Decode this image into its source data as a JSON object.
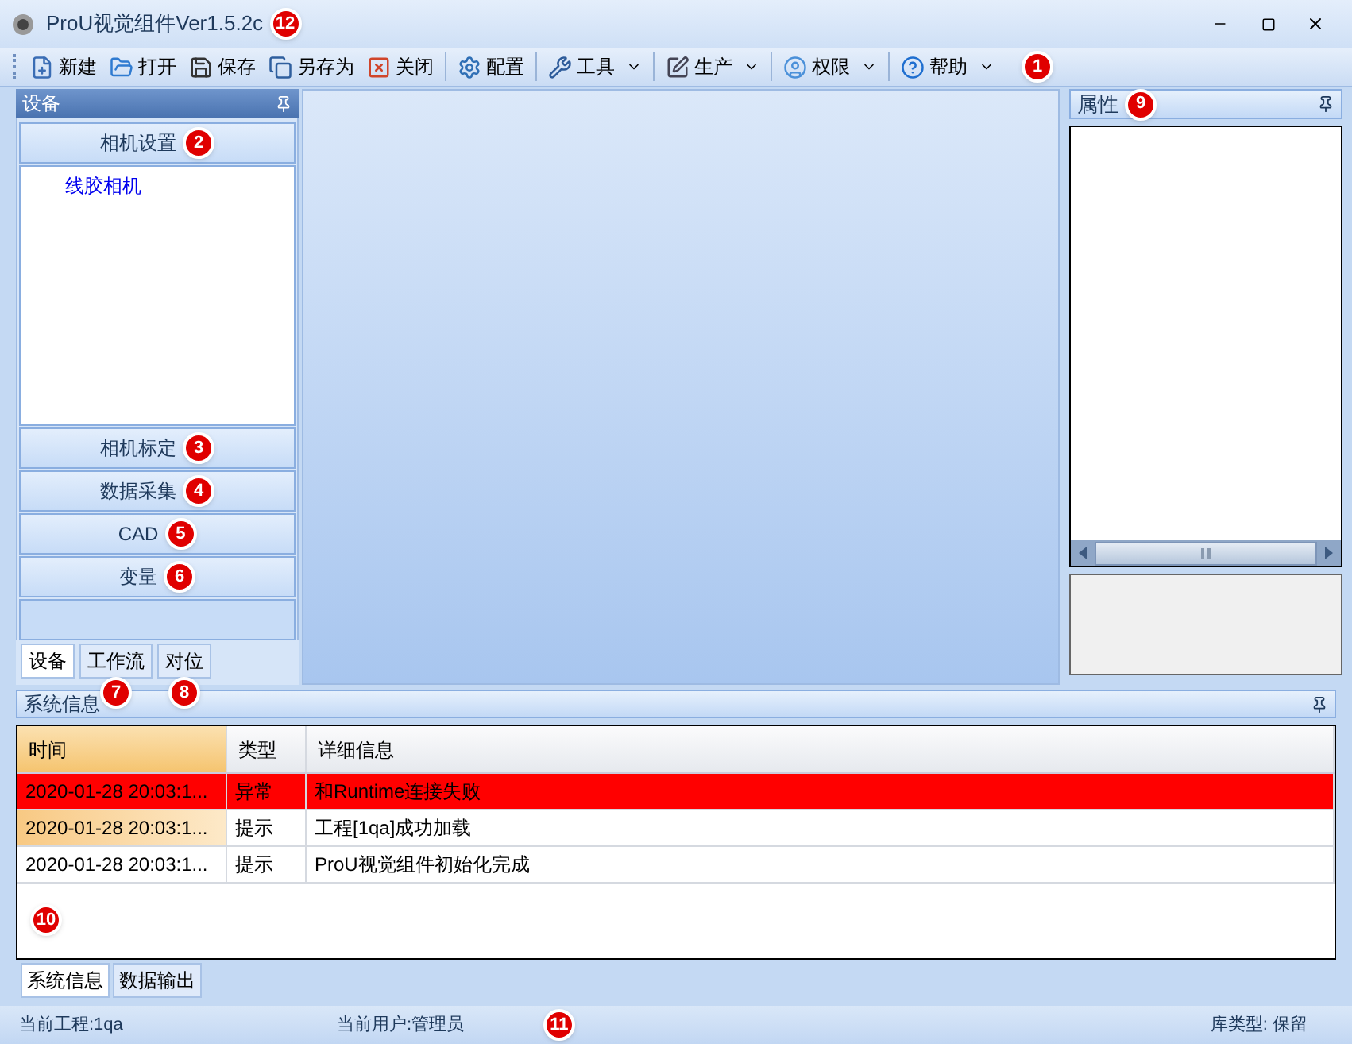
{
  "window": {
    "title": "ProU视觉组件Ver1.5.2c",
    "callout": "12"
  },
  "toolbar": {
    "callout": "1",
    "groups": [
      [
        {
          "label": "新建",
          "dropdown": false
        },
        {
          "label": "打开",
          "dropdown": false
        },
        {
          "label": "保存",
          "dropdown": false
        },
        {
          "label": "另存为",
          "dropdown": false
        },
        {
          "label": "关闭",
          "dropdown": false
        }
      ],
      [
        {
          "label": "配置",
          "dropdown": false
        }
      ],
      [
        {
          "label": "工具",
          "dropdown": true
        }
      ],
      [
        {
          "label": "生产",
          "dropdown": true
        }
      ],
      [
        {
          "label": "权限",
          "dropdown": true
        }
      ],
      [
        {
          "label": "帮助",
          "dropdown": true
        }
      ]
    ]
  },
  "left_panel": {
    "title": "设备",
    "sections": [
      {
        "label": "相机设置",
        "callout": "2",
        "items": [
          "线胶相机"
        ]
      },
      {
        "label": "相机标定",
        "callout": "3"
      },
      {
        "label": "数据采集",
        "callout": "4"
      },
      {
        "label": "CAD",
        "callout": "5"
      },
      {
        "label": "变量",
        "callout": "6"
      }
    ],
    "tabs": [
      {
        "label": "设备",
        "selected": true
      },
      {
        "label": "工作流",
        "selected": false,
        "callout": "7"
      },
      {
        "label": "对位",
        "selected": false,
        "callout": "8"
      }
    ]
  },
  "properties_panel": {
    "title": "属性",
    "callout": "9"
  },
  "system_info": {
    "title": "系统信息",
    "callout": "10",
    "columns": [
      {
        "label": "时间",
        "selected": true
      },
      {
        "label": "类型",
        "selected": false
      },
      {
        "label": "详细信息",
        "selected": false
      }
    ],
    "rows": [
      {
        "kind": "error",
        "selected": false,
        "cells": [
          "2020-01-28 20:03:1...",
          "异常",
          "和Runtime连接失败"
        ]
      },
      {
        "kind": "info",
        "selected": true,
        "cells": [
          "2020-01-28 20:03:1...",
          "提示",
          "工程[1qa]成功加载"
        ]
      },
      {
        "kind": "info",
        "selected": false,
        "cells": [
          "2020-01-28 20:03:1...",
          "提示",
          "ProU视觉组件初始化完成"
        ]
      }
    ],
    "tabs": [
      {
        "label": "系统信息",
        "selected": true
      },
      {
        "label": "数据输出",
        "selected": false
      }
    ]
  },
  "status_bar": {
    "callout": "11",
    "items": [
      "当前工程:1qa",
      "当前用户:管理员",
      "库类型: 保留"
    ]
  }
}
